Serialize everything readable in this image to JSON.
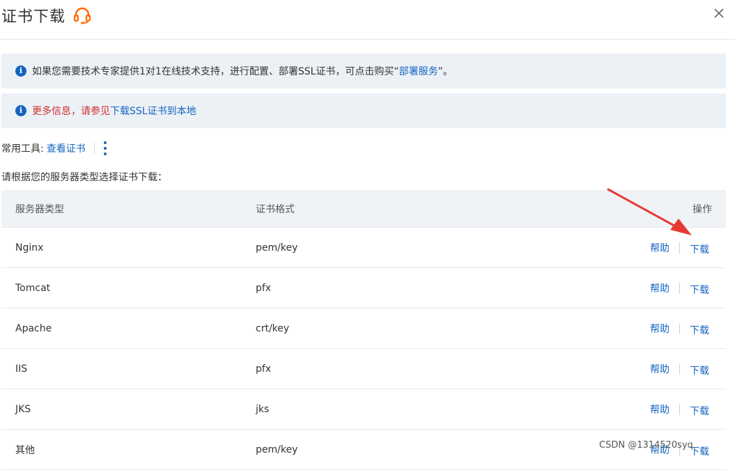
{
  "dialog": {
    "title": "证书下载",
    "close_icon": "close-icon",
    "headset_icon": "headset-icon"
  },
  "notice1": {
    "text": "如果您需要技术专家提供1对1在线技术支持，进行配置、部署SSL证书，可点击购买“",
    "link": "部署服务",
    "suffix": "”。"
  },
  "notice2": {
    "text": "更多信息，请参见",
    "link": "下载SSL证书到本地"
  },
  "tools": {
    "label": "常用工具:",
    "link": "查看证书",
    "more_icon": "more-vertical-icon"
  },
  "prompt": "请根据您的服务器类型选择证书下载：",
  "table": {
    "headers": [
      "服务器类型",
      "证书格式",
      "操作"
    ],
    "help_label": "帮助",
    "download_label": "下载",
    "rows": [
      {
        "type": "Nginx",
        "format": "pem/key"
      },
      {
        "type": "Tomcat",
        "format": "pfx"
      },
      {
        "type": "Apache",
        "format": "crt/key"
      },
      {
        "type": "IIS",
        "format": "pfx"
      },
      {
        "type": "JKS",
        "format": "jks"
      },
      {
        "type": "其他",
        "format": "pem/key"
      }
    ]
  },
  "colors": {
    "link": "#1565c0",
    "alert_bg": "#ecf1f6",
    "red": "#d32f2f",
    "arrow": "#e53935"
  },
  "watermark": "CSDN @1314520syq"
}
